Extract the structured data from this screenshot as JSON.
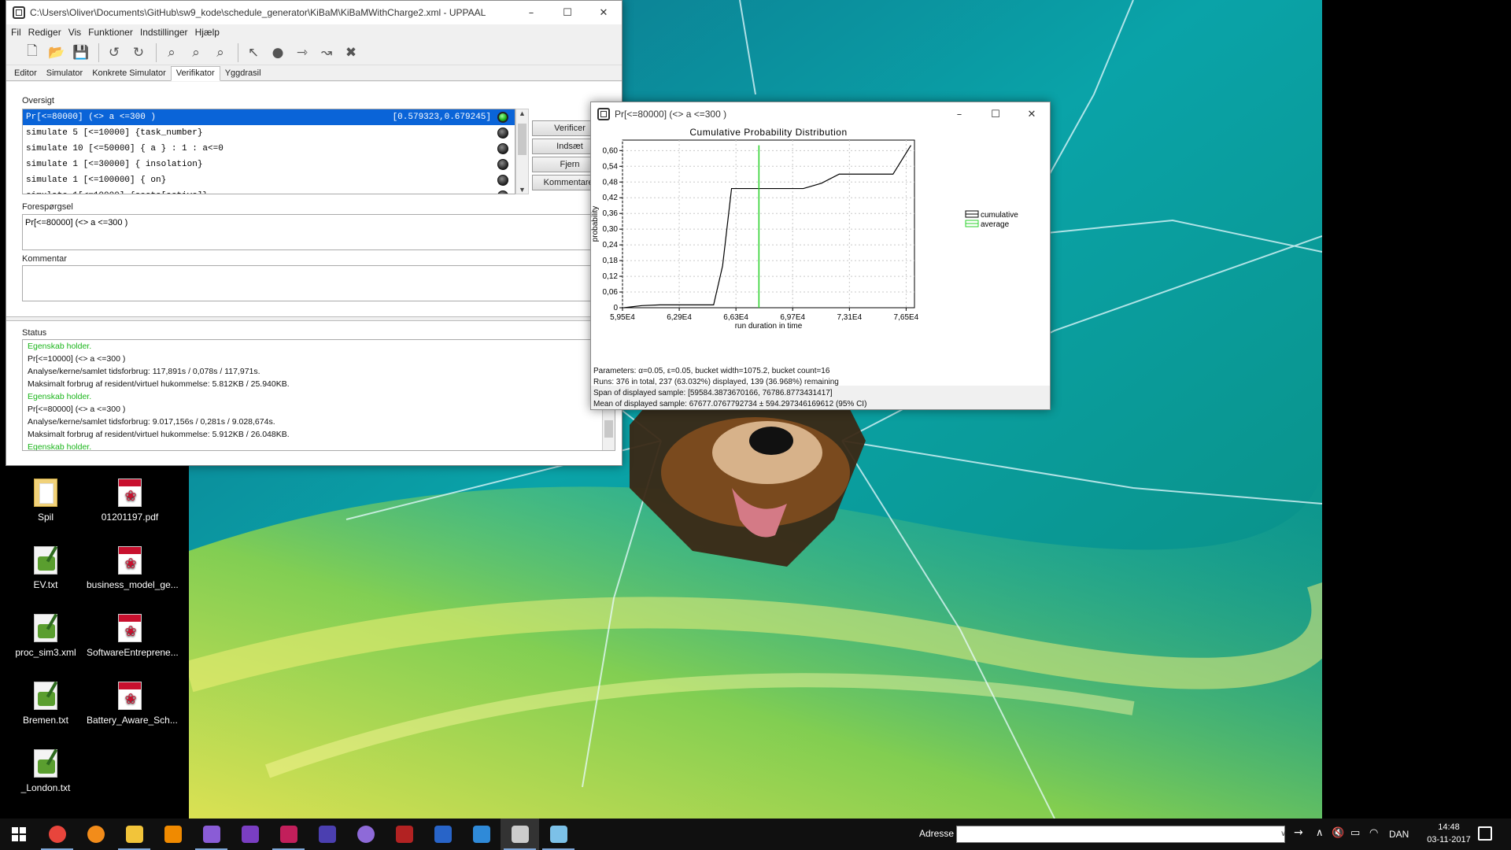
{
  "desktop": {
    "icons": [
      {
        "label": "Spil",
        "type": "folder"
      },
      {
        "label": "01201197.pdf",
        "type": "pdf"
      },
      {
        "label": "EV.txt",
        "type": "txt"
      },
      {
        "label": "business_model_ge...",
        "type": "pdf"
      },
      {
        "label": "proc_sim3.xml",
        "type": "txt"
      },
      {
        "label": "SoftwareEntreprene...",
        "type": "pdf"
      },
      {
        "label": "Bremen.txt",
        "type": "txt"
      },
      {
        "label": "Battery_Aware_Sch...",
        "type": "pdf"
      },
      {
        "label": "_London.txt",
        "type": "txt"
      }
    ]
  },
  "uppaal": {
    "title": "C:\\Users\\Oliver\\Documents\\GitHub\\sw9_kode\\schedule_generator\\KiBaM\\KiBaMWithCharge2.xml - UPPAAL",
    "menu": [
      "Fil",
      "Rediger",
      "Vis",
      "Funktioner",
      "Indstillinger",
      "Hjælp"
    ],
    "toolbar_icons": [
      "new-icon",
      "open-icon",
      "save-icon",
      "undo-icon",
      "redo-icon",
      "zoom-in-icon",
      "zoom-normal-icon",
      "zoom-out-icon",
      "select-tool-icon",
      "location-tool-icon",
      "edge-tool-icon",
      "nail-tool-icon",
      "trash-tool-icon"
    ],
    "tabs": [
      "Editor",
      "Simulator",
      "Konkrete Simulator",
      "Verifikator",
      "Yggdrasil"
    ],
    "active_tab": "Verifikator",
    "overview_label": "Oversigt",
    "queries": [
      {
        "text": "Pr[<=80000] (<> a <=300 )",
        "result": "[0.579323,0.679245]",
        "status": "green"
      },
      {
        "text": "simulate 5 [<=10000] {task_number}",
        "result": "",
        "status": "grey"
      },
      {
        "text": "simulate 10 [<=50000] { a } : 1 : a<=0",
        "result": "",
        "status": "grey"
      },
      {
        "text": "simulate 1 [<=30000] { insolation}",
        "result": "",
        "status": "grey"
      },
      {
        "text": "simulate 1 [<=100000] { on}",
        "result": "",
        "status": "grey"
      },
      {
        "text": "simulate 1[<=10000] {costs[active]}",
        "result": "",
        "status": "grey"
      }
    ],
    "buttons": {
      "verify": "Verificer",
      "insert": "Indsæt",
      "remove": "Fjern",
      "comment": "Kommentarer"
    },
    "query_label": "Forespørgsel",
    "query_value": "Pr[<=80000] (<> a <=300 )",
    "comment_label": "Kommentar",
    "status_label": "Status",
    "status_lines": [
      {
        "text": "Egenskab holder.",
        "ok": true
      },
      {
        "text": "Pr[<=10000] (<> a <=300 )",
        "ok": false
      },
      {
        "text": "Analyse/kerne/samlet tidsforbrug: 117,891s / 0,078s / 117,971s.",
        "ok": false
      },
      {
        "text": "Maksimalt forbrug af resident/virtuel hukommelse: 5.812KB / 25.940KB.",
        "ok": false
      },
      {
        "text": "Egenskab holder.",
        "ok": true
      },
      {
        "text": "Pr[<=80000] (<> a <=300 )",
        "ok": false
      },
      {
        "text": "Analyse/kerne/samlet tidsforbrug: 9.017,156s / 0,281s / 9.028,674s.",
        "ok": false
      },
      {
        "text": "Maksimalt forbrug af resident/virtuel hukommelse: 5.912KB / 26.048KB.",
        "ok": false
      },
      {
        "text": "Egenskab holder.",
        "ok": true
      }
    ]
  },
  "plot_window": {
    "title": "Pr[<=80000] (<> a <=300 )",
    "info": [
      "Parameters: α=0.05, ε=0.05, bucket width=1075.2, bucket count=16",
      "Runs: 376 in total, 237 (63.032%) displayed, 139 (36.968%) remaining",
      "Span of displayed sample: [59584.3873670166, 76786.8773431417]",
      "Mean of displayed sample: 67677.0767792734 ± 594.297346169612 (95% CI)"
    ]
  },
  "chart_data": {
    "type": "line",
    "title": "Cumulative Probability Distribution",
    "xlabel": "run duration in time",
    "ylabel": "probability",
    "xlim": [
      59500,
      77000
    ],
    "ylim": [
      0,
      0.64
    ],
    "x_tick_labels": [
      "5,95E4",
      "6,29E4",
      "6,63E4",
      "6,97E4",
      "7,31E4",
      "7,65E4"
    ],
    "x_tick_values": [
      59500,
      62900,
      66300,
      69700,
      73100,
      76500
    ],
    "y_tick_labels": [
      "0",
      "0,06",
      "0,12",
      "0,18",
      "0,24",
      "0,30",
      "0,36",
      "0,42",
      "0,48",
      "0,54",
      "0,60"
    ],
    "y_tick_values": [
      0,
      0.06,
      0.12,
      0.18,
      0.24,
      0.3,
      0.36,
      0.42,
      0.48,
      0.54,
      0.6
    ],
    "grid": true,
    "legend_position": "right",
    "series": [
      {
        "name": "cumulative",
        "color": "#000000",
        "x": [
          59584,
          60660,
          61735,
          62810,
          63886,
          64961,
          65500,
          66036,
          67112,
          68187,
          69262,
          70338,
          71413,
          72488,
          73564,
          74639,
          75714,
          76787
        ],
        "y": [
          0.0,
          0.008,
          0.011,
          0.011,
          0.011,
          0.011,
          0.16,
          0.455,
          0.455,
          0.455,
          0.455,
          0.455,
          0.475,
          0.51,
          0.51,
          0.51,
          0.51,
          0.62
        ]
      },
      {
        "name": "average",
        "color": "#2bd12b",
        "x": [
          67677,
          67677
        ],
        "y": [
          0,
          0.62
        ]
      }
    ]
  },
  "taskbar": {
    "apps": [
      {
        "name": "chrome",
        "color": "#e8453c"
      },
      {
        "name": "firefox",
        "color": "#f28c1a"
      },
      {
        "name": "file-explorer",
        "color": "#f2c43a"
      },
      {
        "name": "vlc",
        "color": "#f08a00"
      },
      {
        "name": "visual-studio",
        "color": "#8a5cd6"
      },
      {
        "name": "visual-studio-code",
        "color": "#7a3ec2"
      },
      {
        "name": "intellij",
        "color": "#c21f5b"
      },
      {
        "name": "game-app",
        "color": "#4b3fb0"
      },
      {
        "name": "app-circle",
        "color": "#8e6ad8"
      },
      {
        "name": "app-red",
        "color": "#b22222"
      },
      {
        "name": "lambda-app",
        "color": "#2864c8"
      },
      {
        "name": "window-app",
        "color": "#2f8ad8"
      },
      {
        "name": "uppaal",
        "color": "#cccccc"
      },
      {
        "name": "paint-app",
        "color": "#7cc1e8"
      }
    ],
    "address_label": "Adresse",
    "address_value": "",
    "language": "DAN",
    "time": "14:48",
    "date": "03-11-2017"
  }
}
